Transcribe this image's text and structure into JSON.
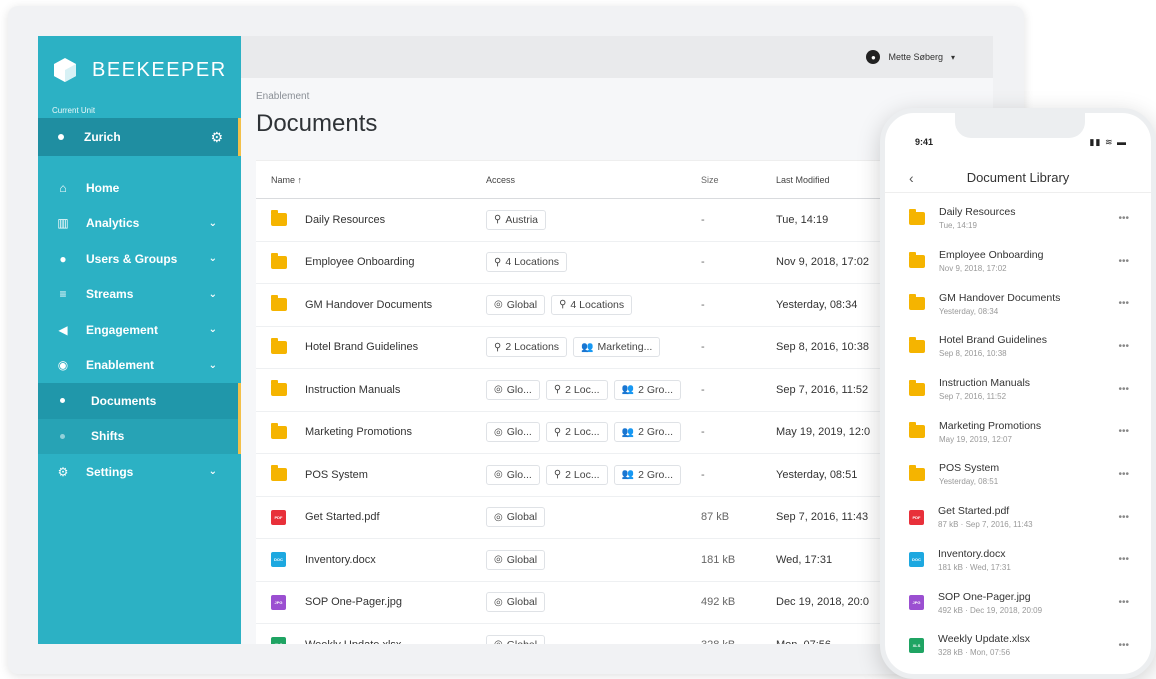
{
  "brand": {
    "name": "BEEKEEPER"
  },
  "sidebar": {
    "current_unit_label": "Current Unit",
    "unit": "Zurich",
    "items": [
      {
        "label": "Home",
        "icon": "home-icon",
        "chevron": false
      },
      {
        "label": "Analytics",
        "icon": "bar-chart-icon",
        "chevron": true
      },
      {
        "label": "Users & Groups",
        "icon": "user-icon",
        "chevron": true
      },
      {
        "label": "Streams",
        "icon": "menu-lines-icon",
        "chevron": true
      },
      {
        "label": "Engagement",
        "icon": "megaphone-icon",
        "chevron": true
      },
      {
        "label": "Enablement",
        "icon": "compass-icon",
        "chevron": true
      }
    ],
    "sub_items": [
      {
        "label": "Documents",
        "active": true
      },
      {
        "label": "Shifts",
        "active": false
      }
    ],
    "settings_label": "Settings"
  },
  "topbar": {
    "user_name": "Mette Søberg"
  },
  "page": {
    "breadcrumb": "Enablement",
    "title": "Documents"
  },
  "table": {
    "headers": {
      "name": "Name ↑",
      "access": "Access",
      "size": "Size",
      "modified": "Last Modified"
    },
    "rows": [
      {
        "type": "folder",
        "name": "Daily Resources",
        "access": [
          {
            "icon": "pin",
            "text": "Austria"
          }
        ],
        "size": "-",
        "modified": "Tue, 14:19"
      },
      {
        "type": "folder",
        "name": "Employee Onboarding",
        "access": [
          {
            "icon": "pin",
            "text": "4 Locations"
          }
        ],
        "size": "-",
        "modified": "Nov 9, 2018, 17:02"
      },
      {
        "type": "folder",
        "name": "GM Handover Documents",
        "access": [
          {
            "icon": "globe",
            "text": "Global"
          },
          {
            "icon": "pin",
            "text": "4 Locations"
          }
        ],
        "size": "-",
        "modified": "Yesterday, 08:34"
      },
      {
        "type": "folder",
        "name": "Hotel Brand Guidelines",
        "access": [
          {
            "icon": "pin",
            "text": "2 Locations"
          },
          {
            "icon": "group",
            "text": "Marketing..."
          }
        ],
        "size": "-",
        "modified": "Sep 8, 2016, 10:38"
      },
      {
        "type": "folder",
        "name": "Instruction Manuals",
        "access": [
          {
            "icon": "globe",
            "text": "Glo..."
          },
          {
            "icon": "pin",
            "text": "2 Loc..."
          },
          {
            "icon": "group",
            "text": "2 Gro..."
          }
        ],
        "size": "-",
        "modified": "Sep 7, 2016, 11:52"
      },
      {
        "type": "folder",
        "name": "Marketing Promotions",
        "access": [
          {
            "icon": "globe",
            "text": "Glo..."
          },
          {
            "icon": "pin",
            "text": "2 Loc..."
          },
          {
            "icon": "group",
            "text": "2 Gro..."
          }
        ],
        "size": "-",
        "modified": "May 19, 2019, 12:0"
      },
      {
        "type": "folder",
        "name": "POS System",
        "access": [
          {
            "icon": "globe",
            "text": "Glo..."
          },
          {
            "icon": "pin",
            "text": "2 Loc..."
          },
          {
            "icon": "group",
            "text": "2 Gro..."
          }
        ],
        "size": "-",
        "modified": "Yesterday, 08:51"
      },
      {
        "type": "pdf",
        "name": "Get Started.pdf",
        "access": [
          {
            "icon": "globe",
            "text": "Global"
          }
        ],
        "size": "87 kB",
        "modified": "Sep 7, 2016, 11:43"
      },
      {
        "type": "doc",
        "name": "Inventory.docx",
        "access": [
          {
            "icon": "globe",
            "text": "Global"
          }
        ],
        "size": "181 kB",
        "modified": "Wed, 17:31"
      },
      {
        "type": "jpg",
        "name": "SOP One-Pager.jpg",
        "access": [
          {
            "icon": "globe",
            "text": "Global"
          }
        ],
        "size": "492 kB",
        "modified": "Dec 19, 2018, 20:0"
      },
      {
        "type": "xls",
        "name": "Weekly Update.xlsx",
        "access": [
          {
            "icon": "globe",
            "text": "Global"
          }
        ],
        "size": "328 kB",
        "modified": "Mon, 07:56"
      }
    ]
  },
  "phone": {
    "time": "9:41",
    "title": "Document Library",
    "items": [
      {
        "type": "folder",
        "name": "Daily Resources",
        "sub": "Tue, 14:19"
      },
      {
        "type": "folder",
        "name": "Employee Onboarding",
        "sub": "Nov 9, 2018, 17:02"
      },
      {
        "type": "folder",
        "name": "GM Handover Documents",
        "sub": "Yesterday, 08:34"
      },
      {
        "type": "folder",
        "name": "Hotel Brand Guidelines",
        "sub": "Sep 8, 2016, 10:38"
      },
      {
        "type": "folder",
        "name": "Instruction Manuals",
        "sub": "Sep 7, 2016, 11:52"
      },
      {
        "type": "folder",
        "name": "Marketing Promotions",
        "sub": "May 19, 2019, 12:07"
      },
      {
        "type": "folder",
        "name": "POS System",
        "sub": "Yesterday, 08:51"
      },
      {
        "type": "pdf",
        "name": "Get Started.pdf",
        "sub": "87 kB · Sep 7, 2016, 11:43"
      },
      {
        "type": "doc",
        "name": "Inventory.docx",
        "sub": "181 kB · Wed, 17:31"
      },
      {
        "type": "jpg",
        "name": "SOP One-Pager.jpg",
        "sub": "492 kB · Dec 19, 2018, 20:09"
      },
      {
        "type": "xls",
        "name": "Weekly Update.xlsx",
        "sub": "328 kB · Mon, 07:56"
      }
    ]
  },
  "colors": {
    "teal": "#2cb1c4",
    "teal_dark": "#1f8ea1",
    "accent": "#f3c04a",
    "folder": "#f5b400",
    "pdf": "#e8303a",
    "doc": "#1da8e0",
    "jpg": "#9b4fd1",
    "xls": "#1fa463"
  },
  "file_badges": {
    "pdf": "PDF",
    "doc": "DOC",
    "jpg": "JPG",
    "xls": "XLS"
  }
}
